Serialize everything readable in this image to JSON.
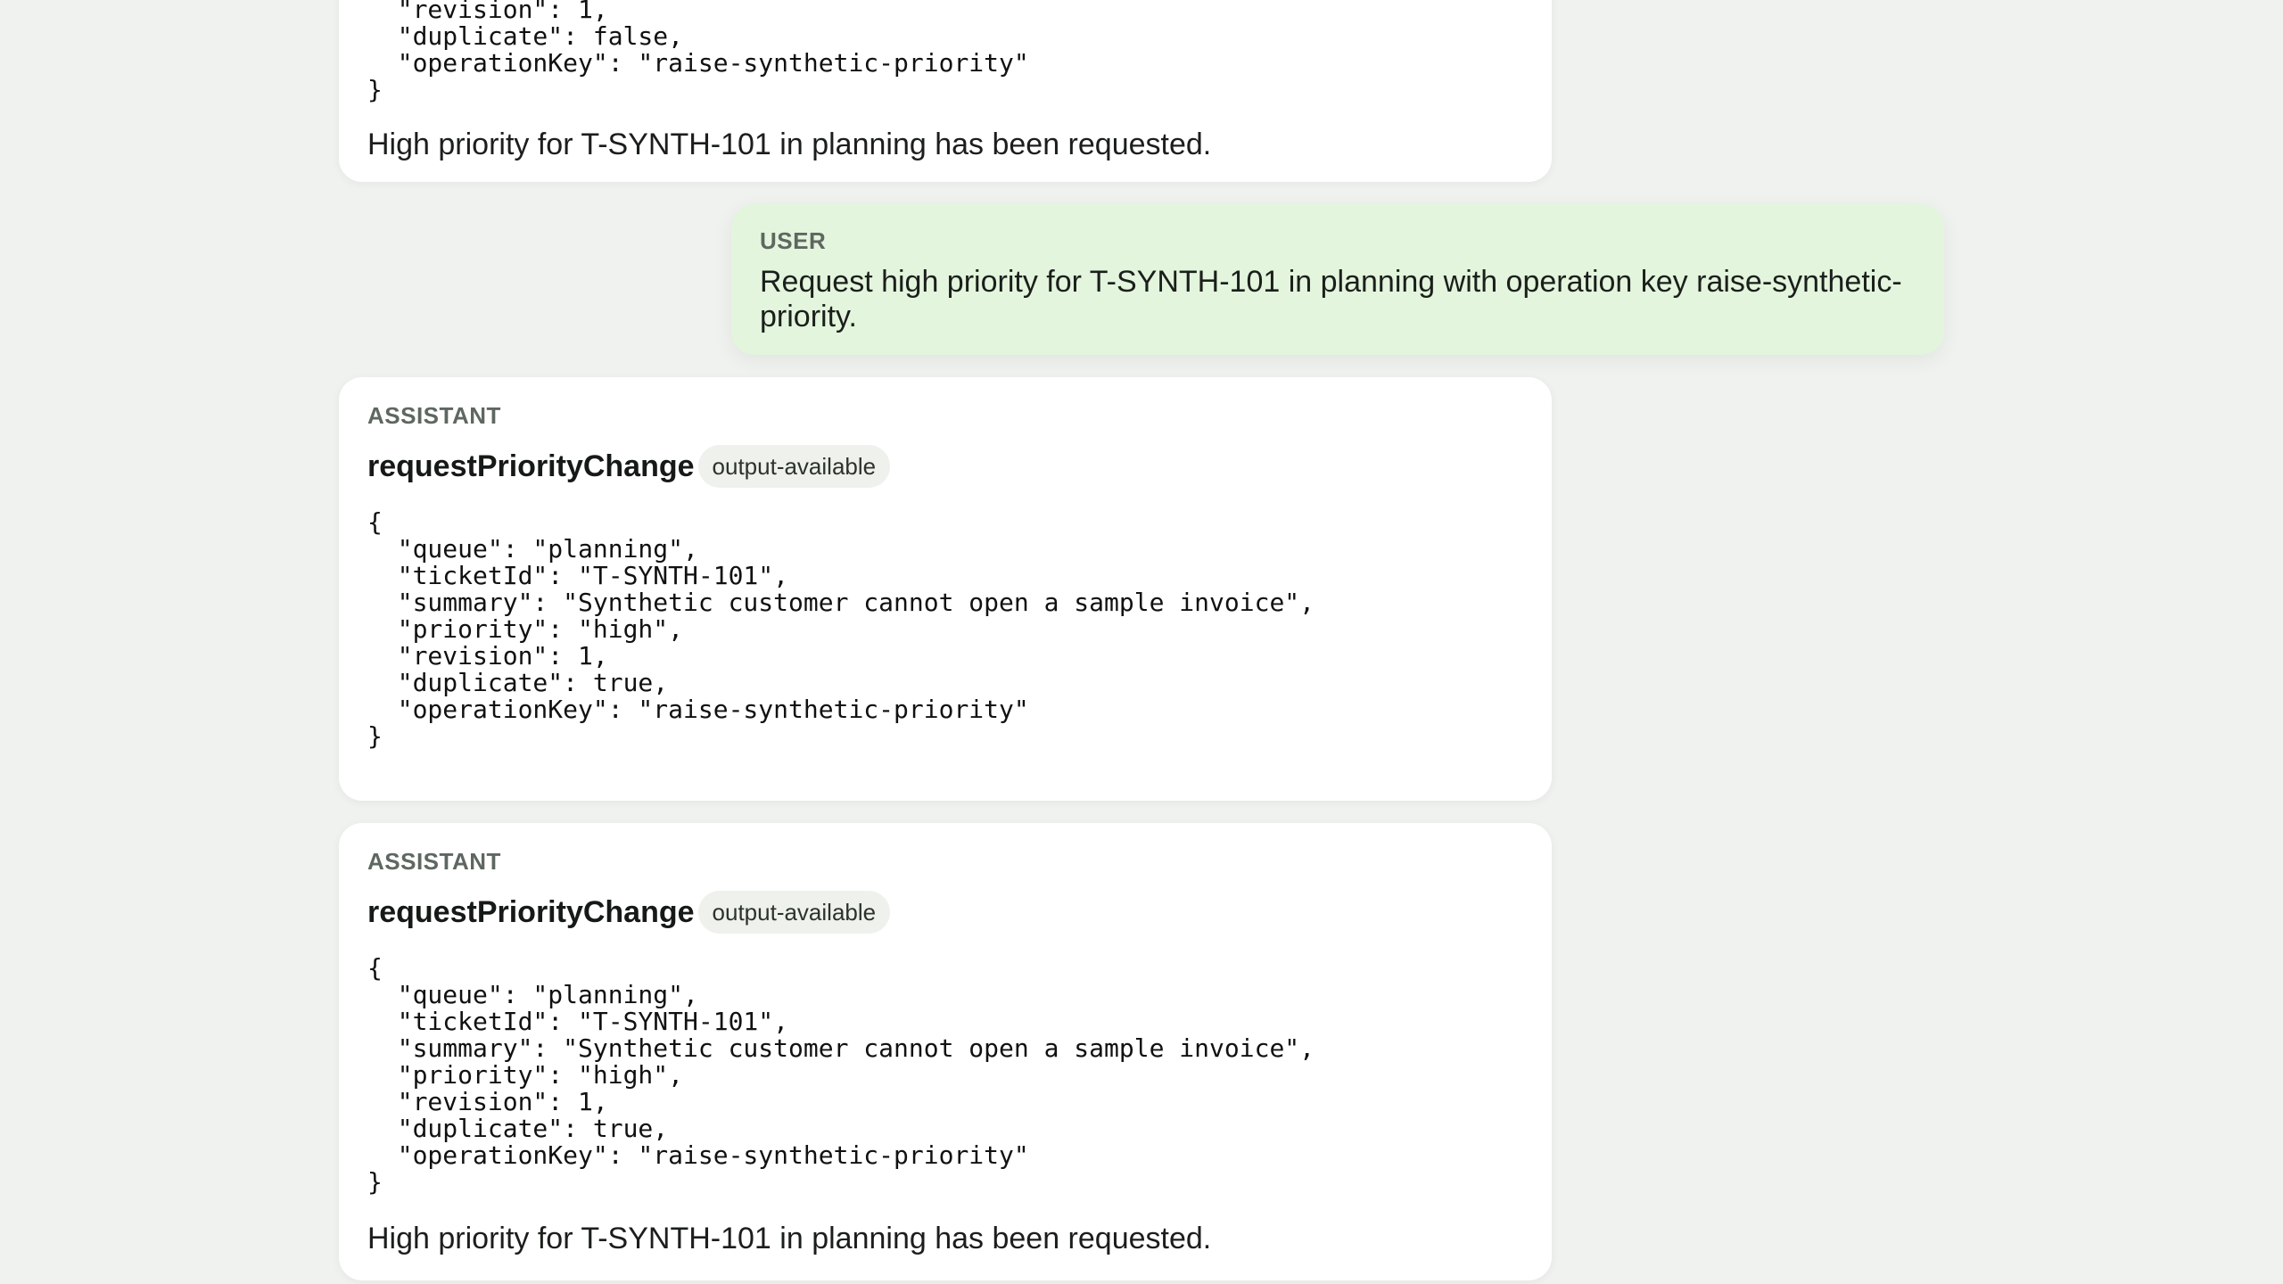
{
  "messages": [
    {
      "role": "",
      "code": "  \"revision\": 1,\n  \"duplicate\": false,\n  \"operationKey\": \"raise-synthetic-priority\"\n}",
      "result": "High priority for T-SYNTH-101 in planning has been requested."
    },
    {
      "role": "USER",
      "text": "Request high priority for T-SYNTH-101 in planning with operation key raise-synthetic-priority."
    },
    {
      "role": "ASSISTANT",
      "tool_name": "requestPriorityChange",
      "status": "output-available",
      "code": "{\n  \"queue\": \"planning\",\n  \"ticketId\": \"T-SYNTH-101\",\n  \"summary\": \"Synthetic customer cannot open a sample invoice\",\n  \"priority\": \"high\",\n  \"revision\": 1,\n  \"duplicate\": true,\n  \"operationKey\": \"raise-synthetic-priority\"\n}"
    },
    {
      "role": "ASSISTANT",
      "tool_name": "requestPriorityChange",
      "status": "output-available",
      "code": "{\n  \"queue\": \"planning\",\n  \"ticketId\": \"T-SYNTH-101\",\n  \"summary\": \"Synthetic customer cannot open a sample invoice\",\n  \"priority\": \"high\",\n  \"revision\": 1,\n  \"duplicate\": true,\n  \"operationKey\": \"raise-synthetic-priority\"\n}",
      "result": "High priority for T-SYNTH-101 in planning has been requested."
    }
  ]
}
